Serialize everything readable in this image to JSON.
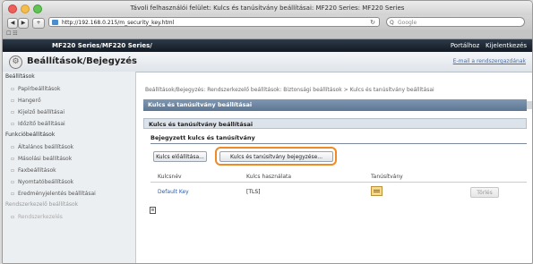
{
  "window": {
    "title": "Távoli felhasználói felület: Kulcs és tanúsítvány beállításai: MF220 Series: MF220 Series"
  },
  "browser": {
    "back_label": "◀",
    "forward_label": "▶",
    "add_label": "+",
    "url": "http://192.168.0.215/m_security_key.html",
    "reload_icon": "↻",
    "search_placeholder": "Google",
    "search_icon_label": "Q",
    "bookmarks_label": "☐ ☷"
  },
  "product_bar": {
    "brand": "",
    "product": "MF220 Series/MF220 Series/",
    "portal_label": "Portálhoz",
    "logout_label": "Kijelentkezés"
  },
  "header": {
    "title": "Beállítások/Bejegyzés",
    "email_link": "E-mail a rendszergazdának"
  },
  "sidebar": {
    "groups": [
      {
        "label": "Beállítások",
        "items": [
          "Papírbeállítások",
          "Hangerő",
          "Kijelző beállításai",
          "Időzítő beállításai"
        ]
      },
      {
        "label": "Funkcióbeállítások",
        "items": [
          "Általános beállítások",
          "Másolási beállítások",
          "Faxbeállítások",
          "Nyomtatóbeállítások",
          "Eredményjelentés beállításai"
        ]
      },
      {
        "label": "Rendszerkezelő beállítások",
        "items": [
          "Rendszerkezelés"
        ]
      }
    ]
  },
  "main": {
    "breadcrumb": "Beállítások/Bejegyzés: Rendszerkezelő beállítások: Biztonsági beállítások > Kulcs és tanúsítvány beállításai",
    "panel_title": "Kulcs és tanúsítvány beállításai",
    "section_title": "Kulcs és tanúsítvány beállításai",
    "sub_title": "Bejegyzett kulcs és tanúsítvány",
    "generate_button": "Kulcs előállítása...",
    "register_button": "Kulcs és tanúsítvány bejegyzése...",
    "table": {
      "headers": [
        "Kulcsnév",
        "Kulcs használata",
        "Tanúsítvány"
      ],
      "rows": [
        {
          "key_name": "Default Key",
          "key_use": "[TLS]",
          "delete_label": "Törlés"
        }
      ]
    },
    "page_icon_label": "≡"
  },
  "colors": {
    "highlight": "#f08a24",
    "panel_bar": "#6b84a1",
    "link": "#2a5da8"
  }
}
